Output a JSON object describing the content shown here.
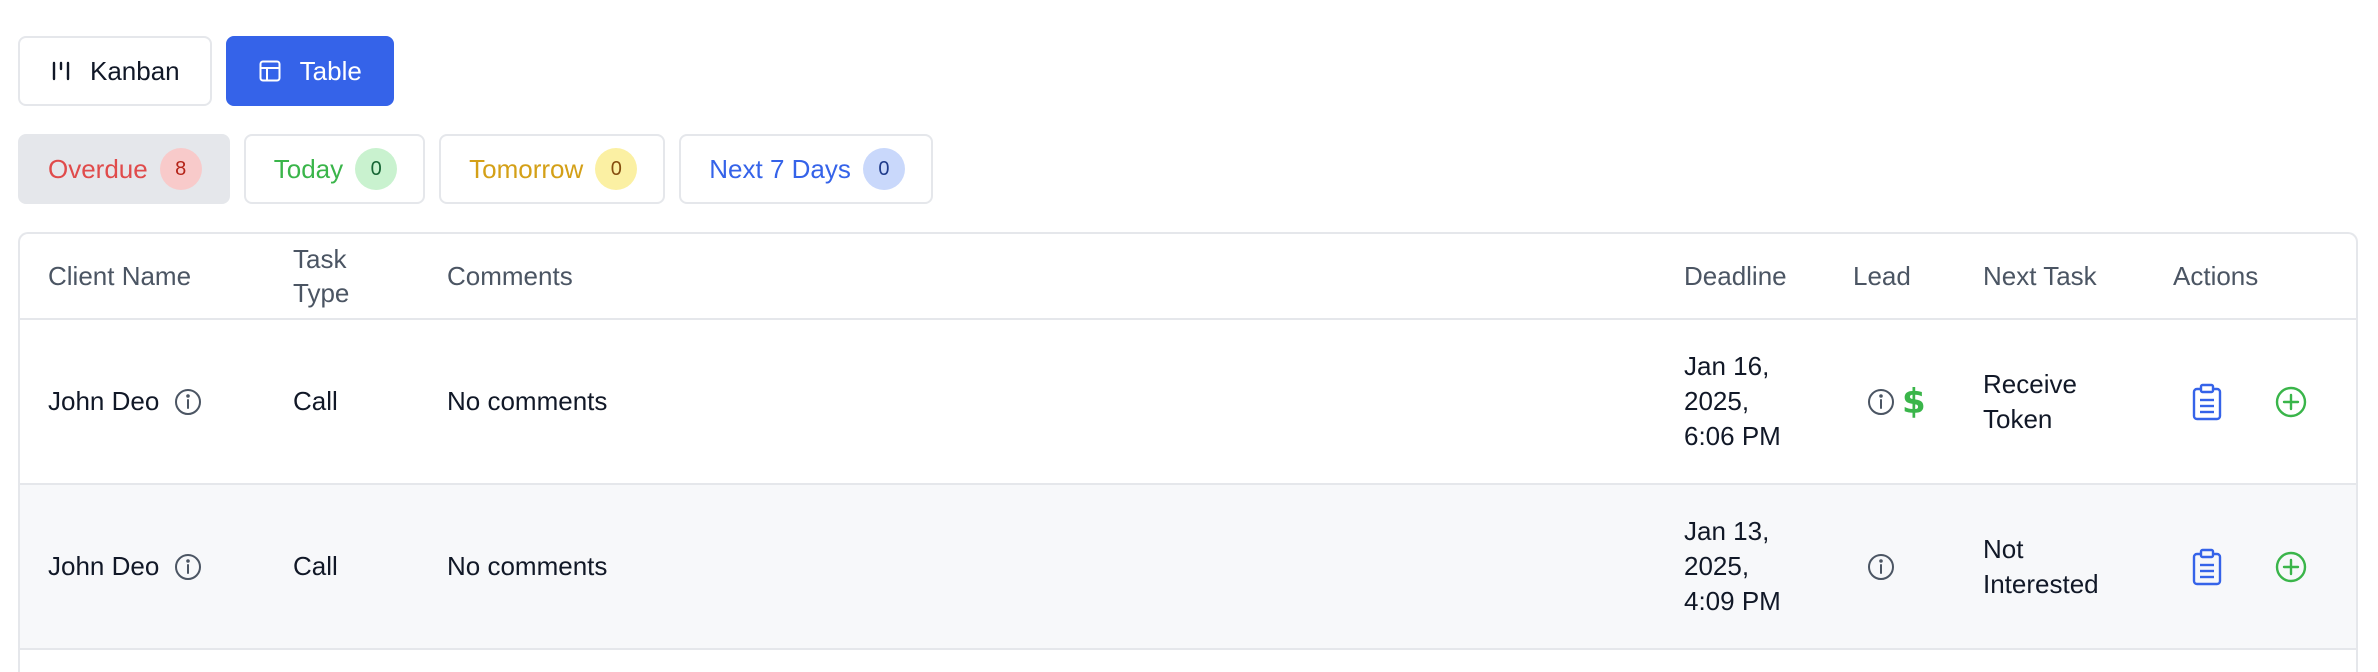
{
  "view_toggle": {
    "kanban_label": "Kanban",
    "table_label": "Table",
    "active": "Table"
  },
  "filters": [
    {
      "label": "Overdue",
      "count": "8",
      "text_color": "#e04b4b",
      "badge_bg": "#f8caca",
      "badge_text": "#b42318",
      "active": true
    },
    {
      "label": "Today",
      "count": "0",
      "text_color": "#3ab54a",
      "badge_bg": "#c9f2cf",
      "badge_text": "#166534",
      "active": false
    },
    {
      "label": "Tomorrow",
      "count": "0",
      "text_color": "#d4a017",
      "badge_bg": "#fbf0a3",
      "badge_text": "#854d0e",
      "active": false
    },
    {
      "label": "Next 7 Days",
      "count": "0",
      "text_color": "#3563e9",
      "badge_bg": "#c9d8fb",
      "badge_text": "#1e3a8a",
      "active": false
    }
  ],
  "table": {
    "headers": {
      "client": "Client Name",
      "type": "Task Type",
      "comments": "Comments",
      "deadline": "Deadline",
      "lead": "Lead",
      "next": "Next Task",
      "actions": "Actions"
    },
    "rows": [
      {
        "client": "John Deo",
        "type": "Call",
        "comments": "No comments",
        "deadline": "Jan 16,\n2025,\n6:06 PM",
        "next_task": "Receive\nToken",
        "lead_dollar": "$"
      },
      {
        "client": "John Deo",
        "type": "Call",
        "comments": "No comments",
        "deadline": "Jan 13,\n2025,\n4:09 PM",
        "next_task": "Not\nInterested",
        "lead_dollar": ""
      }
    ]
  },
  "colors": {
    "accent": "#3563e9",
    "success": "#3ab54a"
  },
  "icons": {
    "kanban": "kanban-icon",
    "table": "table-icon",
    "info": "info-icon",
    "dollar": "dollar-icon",
    "clipboard": "clipboard-icon",
    "add": "plus-circle-icon"
  }
}
